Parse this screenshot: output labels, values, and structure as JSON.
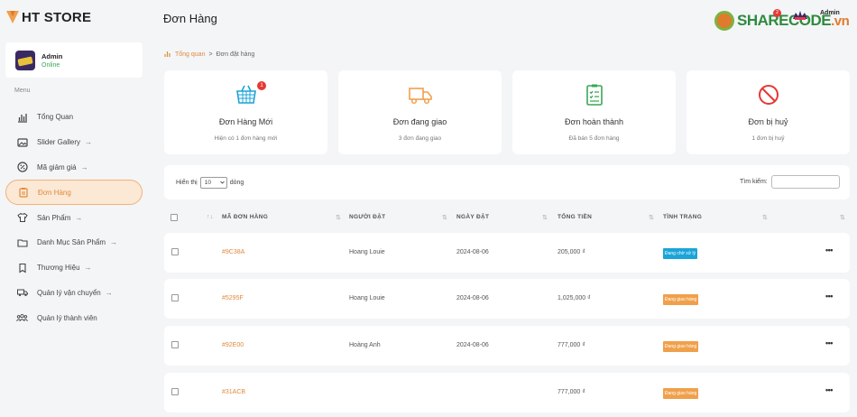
{
  "brand": {
    "name": "HT STORE"
  },
  "user": {
    "name": "Admin",
    "status": "Online"
  },
  "menu": {
    "heading": "Menu",
    "items": [
      {
        "label": "Tổng Quan",
        "icon": "chart-bar-icon",
        "arrow": ""
      },
      {
        "label": "Slider Gallery",
        "icon": "image-icon",
        "arrow": "→"
      },
      {
        "label": "Mã giảm giá",
        "icon": "coupon-icon",
        "arrow": "→"
      },
      {
        "label": "Đơn Hàng",
        "icon": "clipboard-icon",
        "arrow": "",
        "active": true
      },
      {
        "label": "Sản Phẩm",
        "icon": "shirt-icon",
        "arrow": "→"
      },
      {
        "label": "Danh Mục Sản Phẩm",
        "icon": "folder-icon",
        "arrow": "→"
      },
      {
        "label": "Thương Hiệu",
        "icon": "bookmark-icon",
        "arrow": "→"
      },
      {
        "label": "Quản lý vận chuyển",
        "icon": "truck-icon",
        "arrow": "→"
      },
      {
        "label": "Quản lý thành viên",
        "icon": "users-icon",
        "arrow": ""
      }
    ]
  },
  "header": {
    "title": "Đơn Hàng",
    "notification_count": "2",
    "admin_label": "Admin",
    "watermark_logo": {
      "main": "SHARECODE",
      "suffix": ".vn"
    }
  },
  "breadcrumb": {
    "home": "Tổng quan",
    "separator": ">",
    "current": "Đơn đặt hàng"
  },
  "stats": [
    {
      "title": "Đơn Hàng Mới",
      "subtitle": "Hiện có 1 đơn hàng mới",
      "icon": "basket-icon",
      "badge": "1",
      "color": "#1ba4d8"
    },
    {
      "title": "Đơn đang giao",
      "subtitle": "3 đơn đang giao",
      "icon": "truck-icon",
      "color": "#f0a04b"
    },
    {
      "title": "Đơn hoàn thành",
      "subtitle": "Đã bán 5 đơn hàng",
      "icon": "checklist-icon",
      "color": "#3aa655"
    },
    {
      "title": "Đơn bị huỷ",
      "subtitle": "1 đơn bị huỷ",
      "icon": "cancel-icon",
      "color": "#e53935"
    }
  ],
  "controls": {
    "show_prefix": "Hiển thị",
    "page_size": "10",
    "show_suffix": "dòng",
    "search_label": "Tìm kiếm:"
  },
  "table": {
    "columns": [
      "MÃ ĐƠN HÀNG",
      "NGƯỜI ĐẶT",
      "NGÀY ĐẶT",
      "TỔNG TIỀN",
      "TÌNH TRẠNG"
    ],
    "rows": [
      {
        "id": "#9C38A",
        "customer": "Hoang Louie",
        "date": "2024-08-06",
        "total": "205,000 ₫",
        "status": "Đang chờ xử lý",
        "status_color": "blue"
      },
      {
        "id": "#5295F",
        "customer": "Hoang Louie",
        "date": "2024-08-06",
        "total": "1,025,000 ₫",
        "status": "Đang giao hàng",
        "status_color": "orange"
      },
      {
        "id": "#92E00",
        "customer": "Hoàng Anh",
        "date": "2024-08-06",
        "total": "777,000 ₫",
        "status": "Đang giao hàng",
        "status_color": "orange"
      },
      {
        "id": "#31ACB",
        "customer": "",
        "date": "",
        "total": "777,000 ₫",
        "status": "Đang giao hàng",
        "status_color": "orange"
      }
    ],
    "actions_label": "•••"
  },
  "colors": {
    "accent": "#e08a3c",
    "active_bg": "#fbe8d5"
  }
}
